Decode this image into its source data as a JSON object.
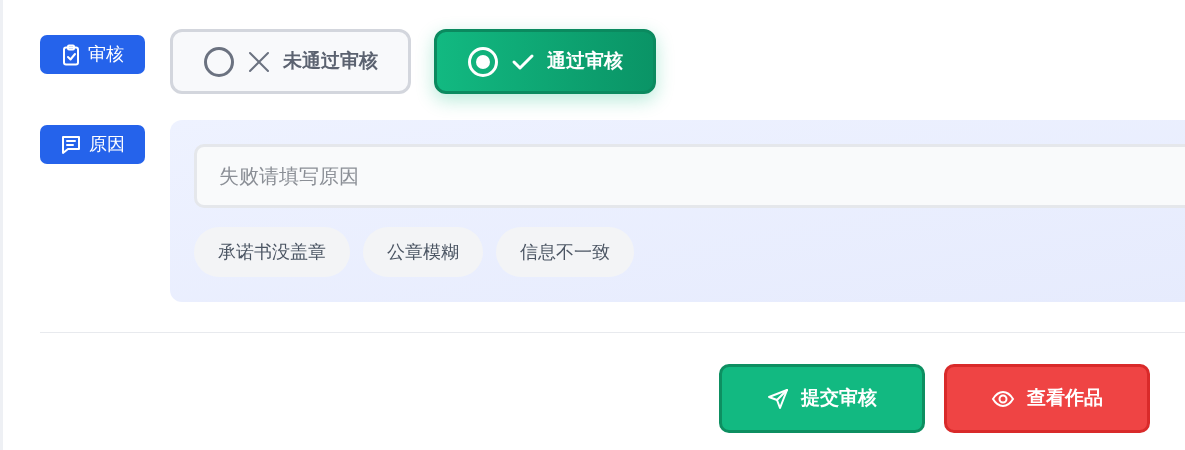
{
  "review": {
    "label": "审核",
    "options": [
      {
        "kind": "reject",
        "label": "未通过审核",
        "selected": false
      },
      {
        "kind": "approve",
        "label": "通过审核",
        "selected": true
      }
    ]
  },
  "reason": {
    "label": "原因",
    "input": {
      "placeholder": "失败请填写原因"
    },
    "chips": [
      "承诺书没盖章",
      "公章模糊",
      "信息不一致"
    ]
  },
  "actions": [
    {
      "kind": "submit",
      "label": "提交审核"
    },
    {
      "kind": "view",
      "label": "查看作品"
    }
  ]
}
